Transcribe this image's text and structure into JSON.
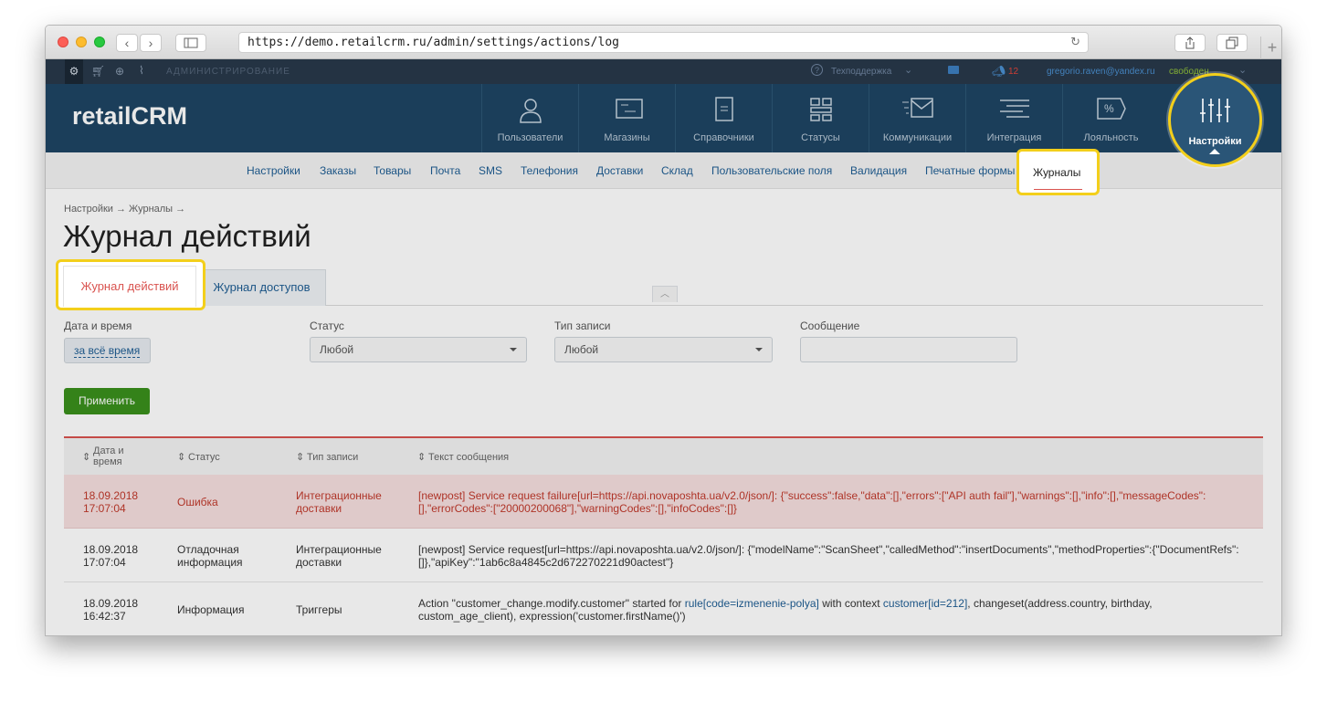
{
  "browser": {
    "url": "https://demo.retailcrm.ru/admin/settings/actions/log"
  },
  "topbar": {
    "admin_label": "АДМИНИСТРИРОВАНИЕ",
    "support_label": "Техподдержка",
    "notifications_count": "12",
    "user_email": "gregorio.raven@yandex.ru",
    "user_status": "свободен"
  },
  "header": {
    "logo_text": "retailCRM",
    "nav": [
      {
        "label": "Пользователи"
      },
      {
        "label": "Магазины"
      },
      {
        "label": "Справочники"
      },
      {
        "label": "Статусы"
      },
      {
        "label": "Коммуникации"
      },
      {
        "label": "Интеграция"
      },
      {
        "label": "Лояльность"
      },
      {
        "label": "Настройки"
      }
    ]
  },
  "subnav": {
    "items": [
      "Настройки",
      "Заказы",
      "Товары",
      "Почта",
      "SMS",
      "Телефония",
      "Доставки",
      "Склад",
      "Пользовательские поля",
      "Валидация",
      "Печатные формы",
      "Журналы"
    ]
  },
  "page": {
    "breadcrumb": "Настройки → Журналы →",
    "title": "Журнал действий",
    "tabs": [
      "Журнал действий",
      "Журнал доступов"
    ]
  },
  "filters": {
    "date_label": "Дата и время",
    "date_value": "за всё время",
    "status_label": "Статус",
    "status_value": "Любой",
    "type_label": "Тип записи",
    "type_value": "Любой",
    "message_label": "Сообщение",
    "message_value": "",
    "apply_button": "Применить"
  },
  "table": {
    "headers": [
      "Дата и время",
      "Статус",
      "Тип записи",
      "Текст сообщения"
    ],
    "rows": [
      {
        "date": "18.09.2018",
        "time": "17:07:04",
        "status": "Ошибка",
        "type_1": "Интеграционные",
        "type_2": "доставки",
        "msg_1": "[newpost] Service request failure[url=https://api.novaposhta.ua/v2.0/json/]: {\"success\":false,\"data\":[],\"errors\":[\"API auth fail\"],\"warnings\":[],\"info\":[],\"messageCodes\":",
        "msg_2": "[],\"errorCodes\":[\"20000200068\"],\"warningCodes\":[],\"infoCodes\":[]}"
      },
      {
        "date": "18.09.2018",
        "time": "17:07:04",
        "status_1": "Отладочная",
        "status_2": "информация",
        "type_1": "Интеграционные",
        "type_2": "доставки",
        "msg_1": "[newpost] Service request[url=https://api.novaposhta.ua/v2.0/json/]: {\"modelName\":\"ScanSheet\",\"calledMethod\":\"insertDocuments\",\"methodProperties\":{\"DocumentRefs\":",
        "msg_2": "[]},\"apiKey\":\"1ab6c8a4845c2d672270221d90actest\"}"
      },
      {
        "date": "18.09.2018",
        "time": "16:42:37",
        "status": "Информация",
        "type": "Триггеры",
        "msg_a": "Action \"customer_change.modify.customer\" started for ",
        "msg_link1": "rule[code=izmenenie-polya]",
        "msg_b": " with context ",
        "msg_link2": "customer[id=212]",
        "msg_c": ", changeset(address.country, birthday,",
        "msg_2": "custom_age_client), expression('customer.firstName()')"
      }
    ]
  },
  "colors": {
    "header_bg": "#1e4563",
    "topbar_bg": "#28394a",
    "accent_red": "#d9534f",
    "highlight": "#f3cf1b",
    "apply_green": "#3a8f1c",
    "link_blue": "#1e5d93"
  }
}
